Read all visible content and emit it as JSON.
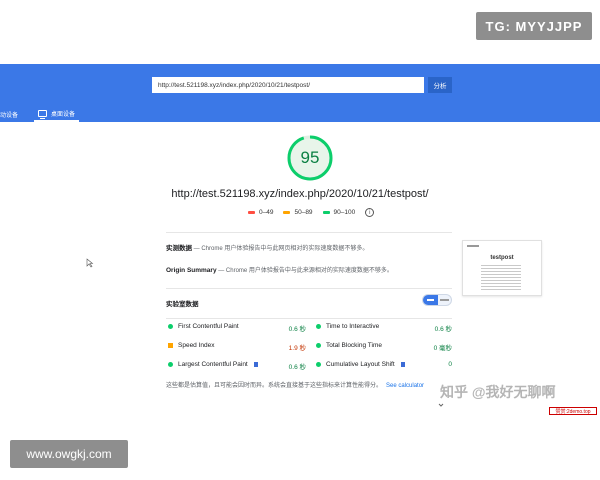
{
  "watermarks": {
    "tg": "TG: MYYJJPP",
    "zhihu": "知乎 @我好无聊啊",
    "red_label": "赞赏:2demo.top",
    "site": "www.owgkj.com"
  },
  "header": {
    "url_value": "http://test.521198.xyz/index.php/2020/10/21/testpost/",
    "analyze_label": "分析",
    "tabs": [
      {
        "label": "动设备",
        "selected": false
      },
      {
        "label": "桌面设备",
        "selected": true
      }
    ],
    "colors": {
      "bar": "#3b78e7"
    }
  },
  "summary": {
    "score": "95",
    "url": "http://test.521198.xyz/index.php/2020/10/21/testpost/",
    "legend": [
      {
        "label": "0–49",
        "color": "#ff4e42"
      },
      {
        "label": "50–89",
        "color": "#ffa400"
      },
      {
        "label": "90–100",
        "color": "#0cce6b"
      }
    ],
    "score_color": "#0b8043"
  },
  "field_data": {
    "title": "实测数据",
    "text": "— Chrome 用户体验报告中与此网页相对的实际速度数据不够多。",
    "origin_title": "Origin Summary",
    "origin_text": "— Chrome 用户体验报告中与此来源相对的实际速度数据不够多。"
  },
  "thumbnail": {
    "title": "testpost"
  },
  "lab_data": {
    "title": "实验室数据",
    "metrics_left": [
      {
        "name": "First Contentful Paint",
        "value": "0.6 秒",
        "status": "green",
        "flag": false
      },
      {
        "name": "Speed Index",
        "value": "1.9 秒",
        "status": "orange",
        "flag": false
      },
      {
        "name": "Largest Contentful Paint",
        "value": "0.6 秒",
        "status": "green",
        "flag": true
      }
    ],
    "metrics_right": [
      {
        "name": "Time to Interactive",
        "value": "0.6 秒",
        "status": "green",
        "flag": false
      },
      {
        "name": "Total Blocking Time",
        "value": "0 毫秒",
        "status": "green",
        "flag": false
      },
      {
        "name": "Cumulative Layout Shift",
        "value": "0",
        "status": "green",
        "flag": true
      }
    ],
    "footnote": "这些都是估算值，且可能会因时而异。系统会直接基于这些指标来计算性能得分。",
    "footnote_link": "See calculator"
  }
}
